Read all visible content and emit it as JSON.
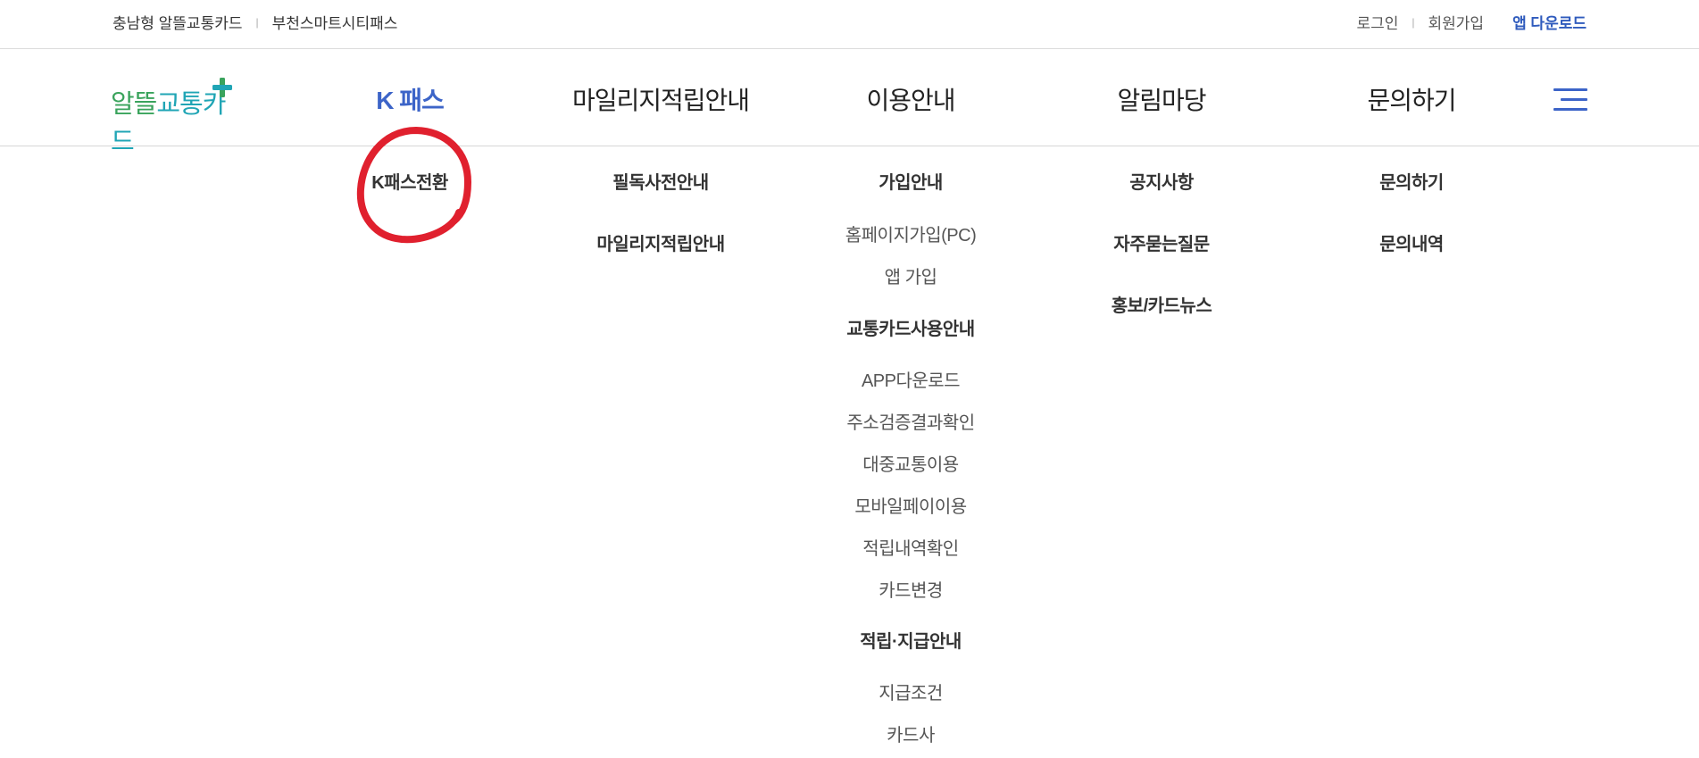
{
  "topbar": {
    "left_links": [
      "충남형 알뜰교통카드",
      "부천스마트시티패스"
    ],
    "separator": "|",
    "login": "로그인",
    "signup": "회원가입",
    "app_download": "앱 다운로드"
  },
  "logo": {
    "part1": "알뜰",
    "part2": "교통카드",
    "plus_icon": "plus-icon"
  },
  "gnb": {
    "menus": [
      "K 패스",
      "마일리지적립안내",
      "이용안내",
      "알림마당",
      "문의하기"
    ],
    "active_menu": "K 패스"
  },
  "submenus": {
    "kpass": [
      "K패스전환"
    ],
    "mileage": [
      "필독사전안내",
      "마일리지적립안내"
    ],
    "usage": {
      "join_title": "가입안내",
      "join_items": [
        "홈페이지가입(PC)",
        "앱 가입"
      ],
      "card_title": "교통카드사용안내",
      "card_items": [
        "APP다운로드",
        "주소검증결과확인",
        "대중교통이용",
        "모바일페이이용",
        "적립내역확인",
        "카드변경"
      ],
      "pay_title": "적립·지급안내",
      "pay_items": [
        "지급조건",
        "카드사"
      ]
    },
    "notice": [
      "공지사항",
      "자주묻는질문",
      "홍보/카드뉴스"
    ],
    "inquiry": [
      "문의하기",
      "문의내역"
    ]
  },
  "colors": {
    "accent": "#3c64c8",
    "annotation": "#e0202e",
    "logo_green": "#3aa35c",
    "logo_teal": "#20a5b5"
  }
}
